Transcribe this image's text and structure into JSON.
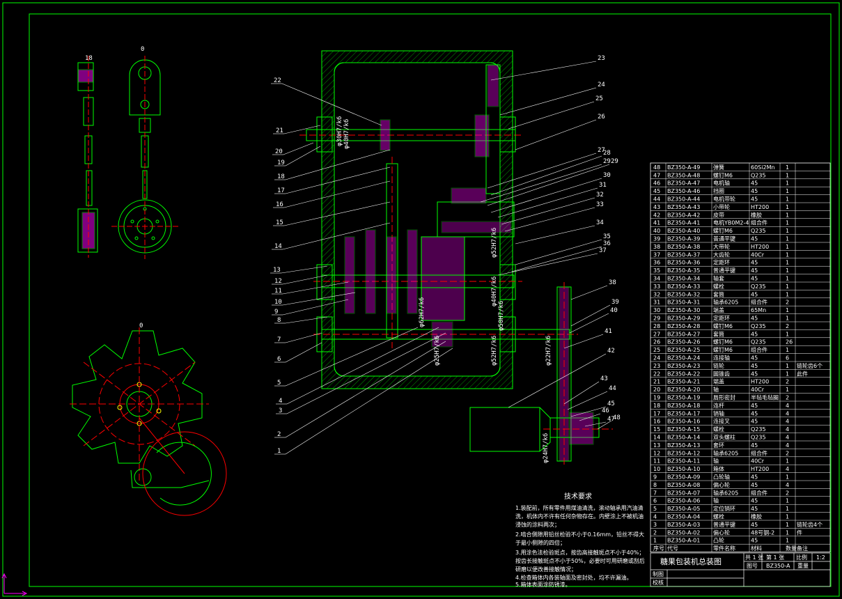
{
  "drawing": {
    "colors": {
      "background": "#000000",
      "frame": "#00ff00",
      "outline": "#00ff00",
      "hatch": "#ff00ff",
      "centerline": "#ff0000",
      "text": "#ffffff",
      "dimension": "#ffffff"
    },
    "view_marks": {
      "top_left": "0",
      "top_mid": "0",
      "bottom_left": "0",
      "center": "0"
    },
    "section_label_18": "18",
    "dimension_labels": [
      "φ30H7/k6",
      "φ40H7/k6",
      "φ52H7/k6",
      "φ40H7/k6",
      "φ50H7/k6",
      "φ62H7/k6",
      "φ25H7/k6",
      "φ52H7/k6",
      "φ22H7/k6",
      "φ24H7/k6"
    ],
    "callouts_left": [
      "22",
      "21",
      "20",
      "19",
      "18",
      "17",
      "16",
      "15",
      "14",
      "13",
      "12",
      "11",
      "10",
      "9",
      "8",
      "7",
      "6",
      "5",
      "4",
      "3",
      "2",
      "1"
    ],
    "callouts_right": [
      "23",
      "24",
      "25",
      "26",
      "27",
      "28",
      "29",
      "29",
      "30",
      "31",
      "32",
      "33",
      "34",
      "35",
      "36",
      "37",
      "38",
      "39",
      "40",
      "41",
      "42",
      "43",
      "44",
      "45",
      "46",
      "47",
      "48"
    ]
  },
  "technical_requirements": {
    "title": "技术要求",
    "lines": [
      "1.装配前，所有零件用煤油清洗，滚动轴承用汽油清",
      "洗，机体内不许有任何杂物存在。内壁涂上不被机油",
      "浸蚀的涂料两次；",
      "2.啮合侧隙用铅丝检验不小于0.16mm，铅丝不得大",
      "于最小侧隙的四倍；",
      "3.用涂色法检验斑点，按齿高接触斑点不小于40%；",
      "按齿长接触斑点不小于50%，必要时可用研磨或刮后",
      "研磨以便改善接触情况；",
      "4.检查箱体内各装轴面及密封处，均不许漏油。",
      "5.箱体表面涂防锈漆。"
    ]
  },
  "bom": {
    "header": {
      "no": "序号",
      "code": "代号",
      "name": "零件名称",
      "material": "材料",
      "qty": "数量",
      "remark": "备注"
    },
    "rows": [
      [
        "48",
        "BZ350-A-49",
        "弹簧",
        "60Si2Mn",
        "1",
        ""
      ],
      [
        "47",
        "BZ350-A-48",
        "螺钉M6",
        "Q235",
        "1",
        ""
      ],
      [
        "46",
        "BZ350-A-47",
        "电机轴",
        "45",
        "1",
        ""
      ],
      [
        "45",
        "BZ350-A-46",
        "挡圈",
        "45",
        "1",
        ""
      ],
      [
        "44",
        "BZ350-A-44",
        "电机带轮",
        "45",
        "1",
        ""
      ],
      [
        "43",
        "BZ350-A-43",
        "小带轮",
        "HT200",
        "1",
        ""
      ],
      [
        "42",
        "BZ350-A-42",
        "皮带",
        "橡胶",
        "1",
        ""
      ],
      [
        "41",
        "BZ350-A-41",
        "电机YB0M2-4",
        "组合件",
        "1",
        ""
      ],
      [
        "40",
        "BZ350-A-40",
        "螺钉M6",
        "Q235",
        "1",
        ""
      ],
      [
        "39",
        "BZ350-A-39",
        "普通平键",
        "45",
        "1",
        ""
      ],
      [
        "38",
        "BZ350-A-38",
        "大带轮",
        "HT200",
        "1",
        ""
      ],
      [
        "37",
        "BZ350-A-37",
        "大齿轮",
        "40Cr",
        "1",
        ""
      ],
      [
        "36",
        "BZ350-A-36",
        "定距环",
        "45",
        "1",
        ""
      ],
      [
        "35",
        "BZ350-A-35",
        "普通平键",
        "45",
        "1",
        ""
      ],
      [
        "34",
        "BZ350-A-34",
        "轴套",
        "45",
        "1",
        ""
      ],
      [
        "33",
        "BZ350-A-33",
        "螺栓",
        "Q235",
        "1",
        ""
      ],
      [
        "32",
        "BZ350-A-32",
        "套筒",
        "45",
        "1",
        ""
      ],
      [
        "31",
        "BZ350-A-31",
        "轴承6205",
        "组合件",
        "2",
        ""
      ],
      [
        "30",
        "BZ350-A-30",
        "端盖",
        "65Mn",
        "1",
        ""
      ],
      [
        "29",
        "BZ350-A-29",
        "定距环",
        "45",
        "1",
        ""
      ],
      [
        "28",
        "BZ350-A-28",
        "螺钉M6",
        "Q235",
        "2",
        ""
      ],
      [
        "27",
        "BZ350-A-27",
        "套筒",
        "45",
        "1",
        ""
      ],
      [
        "26",
        "BZ350-A-26",
        "螺钉M6",
        "Q235",
        "26",
        ""
      ],
      [
        "25",
        "BZ350-A-25",
        "螺钉M6",
        "组合件",
        "1",
        ""
      ],
      [
        "24",
        "BZ350-A-24",
        "连接轴",
        "45",
        "6",
        ""
      ],
      [
        "23",
        "BZ350-A-23",
        "链轮",
        "45",
        "1",
        "链轮齿6个"
      ],
      [
        "22",
        "BZ350-A-22",
        "圆锥齿",
        "45",
        "1",
        "此件"
      ],
      [
        "21",
        "BZ350-A-21",
        "端盖",
        "HT200",
        "2",
        ""
      ],
      [
        "20",
        "BZ350-A-20",
        "轴",
        "40Cr",
        "1",
        ""
      ],
      [
        "19",
        "BZ350-A-19",
        "唇形密封",
        "半毡毛毡圈",
        "2",
        ""
      ],
      [
        "18",
        "BZ350-A-18",
        "连杆",
        "45",
        "4",
        ""
      ],
      [
        "17",
        "BZ350-A-17",
        "销轴",
        "45",
        "4",
        ""
      ],
      [
        "16",
        "BZ350-A-16",
        "连接叉",
        "45",
        "4",
        ""
      ],
      [
        "15",
        "BZ350-A-15",
        "螺栓",
        "Q235",
        "4",
        ""
      ],
      [
        "14",
        "BZ350-A-14",
        "双头螺柱",
        "Q235",
        "4",
        ""
      ],
      [
        "13",
        "BZ350-A-13",
        "套环",
        "45",
        "4",
        ""
      ],
      [
        "12",
        "BZ350-A-12",
        "轴承6205",
        "组合件",
        "2",
        ""
      ],
      [
        "11",
        "BZ350-A-11",
        "轴",
        "40Cr",
        "1",
        ""
      ],
      [
        "10",
        "BZ350-A-10",
        "箱体",
        "HT200",
        "4",
        ""
      ],
      [
        "9",
        "BZ350-A-09",
        "凸轮轴",
        "45",
        "1",
        ""
      ],
      [
        "8",
        "BZ350-A-08",
        "偏心轮",
        "45",
        "4",
        ""
      ],
      [
        "7",
        "BZ350-A-07",
        "轴承6205",
        "组合件",
        "2",
        ""
      ],
      [
        "6",
        "BZ350-A-06",
        "轴",
        "45",
        "1",
        ""
      ],
      [
        "5",
        "BZ350-A-05",
        "定位销环",
        "45",
        "1",
        ""
      ],
      [
        "4",
        "BZ350-A-04",
        "螺栓",
        "橡胶",
        "1",
        ""
      ],
      [
        "3",
        "BZ350-A-03",
        "普通平键",
        "45",
        "1",
        "链轮齿4个"
      ],
      [
        "2",
        "BZ350-A-02",
        "偏心轮",
        "48号钢-2",
        "1",
        "件"
      ],
      [
        "1",
        "BZ350-A-01",
        "凸轮",
        "45",
        "1",
        ""
      ]
    ]
  },
  "title_block": {
    "title": "糖果包装机总装图",
    "sheet_total": "共 1 张",
    "sheet_no": "第 1 张",
    "scale_label": "比例",
    "scale_value": "1:2",
    "drawing_no_label": "图号",
    "drawing_no": "BZ350-A",
    "weight_label": "重量",
    "designed": "制图",
    "checked": "校核"
  }
}
